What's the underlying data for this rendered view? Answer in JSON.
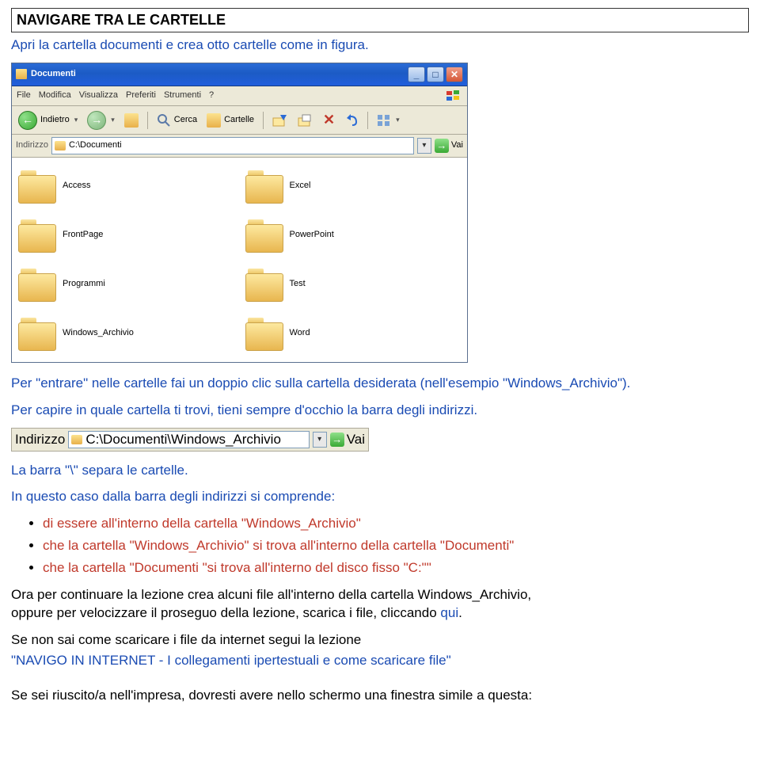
{
  "title": "NAVIGARE TRA LE CARTELLE",
  "subtitle": "Apri la cartella documenti e crea otto cartelle come in figura.",
  "win": {
    "title": "Documenti",
    "menu": [
      "File",
      "Modifica",
      "Visualizza",
      "Preferiti",
      "Strumenti",
      "?"
    ],
    "toolbar": {
      "back": "Indietro",
      "search": "Cerca",
      "folders": "Cartelle"
    },
    "address": {
      "label": "Indirizzo",
      "value": "C:\\Documenti",
      "go": "Vai"
    },
    "folders": [
      [
        "Access",
        "Excel"
      ],
      [
        "FrontPage",
        "PowerPoint"
      ],
      [
        "Programmi",
        "Test"
      ],
      [
        "Windows_Archivio",
        "Word"
      ]
    ]
  },
  "p1a": "Per \"entrare\" nelle cartelle fai un doppio clic sulla cartella desiderata (nell'esempio \"Windows_Archivio\").",
  "p1b": "Per capire in quale cartella ti trovi, tieni sempre d'occhio la barra degli indirizzi.",
  "addr2": {
    "label": "Indirizzo",
    "value": "C:\\Documenti\\Windows_Archivio",
    "go": "Vai"
  },
  "p2": "La barra \"\\\" separa le cartelle.",
  "p3": "In questo caso dalla barra degli indirizzi si comprende:",
  "bullets": [
    "di essere all'interno della cartella \"Windows_Archivio\"",
    "che la cartella \"Windows_Archivio\" si trova all'interno della cartella \"Documenti\"",
    "che la cartella \"Documenti \"si trova all'interno del disco fisso \"C:\"\""
  ],
  "p4a": "Ora per continuare la lezione crea alcuni file all'interno della cartella Windows_Archivio,",
  "p4b": "oppure per velocizzare il proseguo della lezione, scarica i file, cliccando ",
  "p4c": "qui",
  "p4d": ".",
  "p5": "Se non sai come scaricare i file da internet segui la lezione",
  "p6": "\"NAVIGO IN INTERNET - I collegamenti ipertestuali e come scaricare file\"",
  "p7": "Se sei riuscito/a nell'impresa, dovresti avere nello schermo una finestra simile a questa:"
}
